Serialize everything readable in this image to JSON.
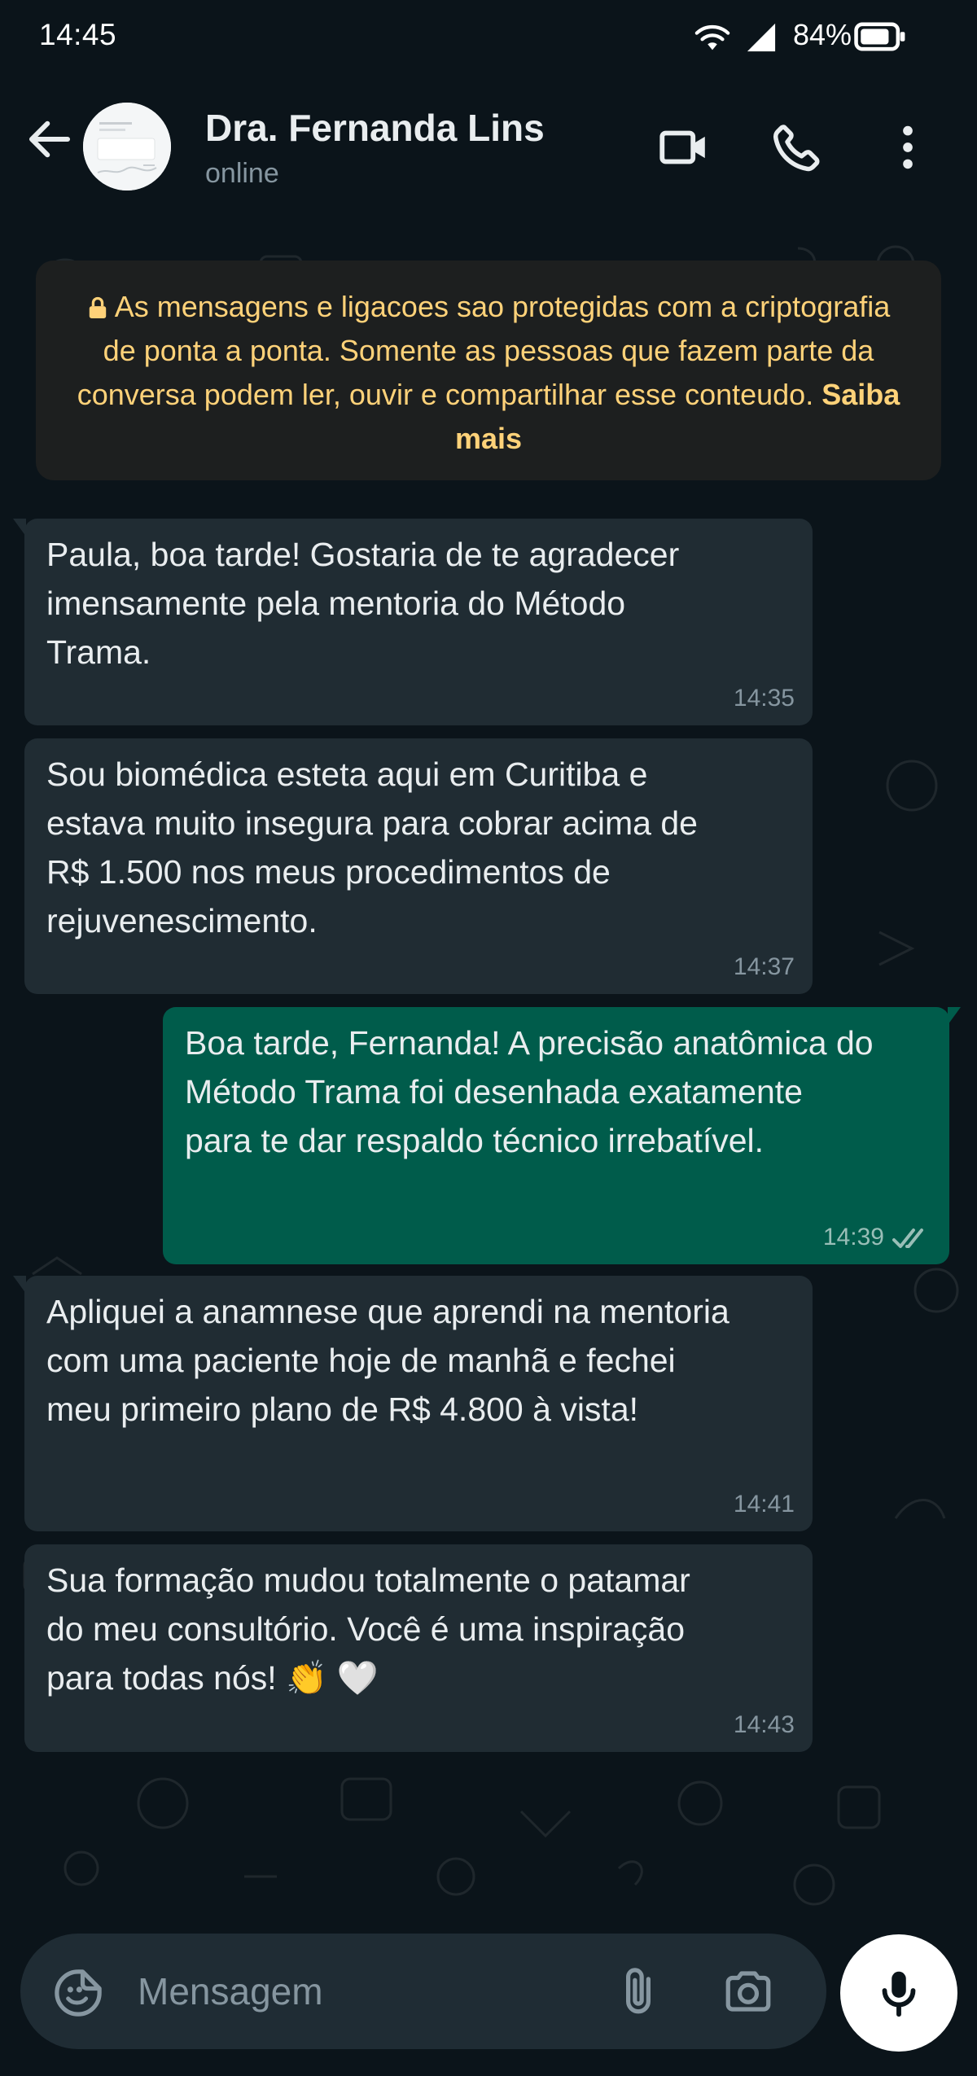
{
  "status_bar": {
    "time": "14:45",
    "battery": "84%"
  },
  "header": {
    "contact_name": "Dra. Fernanda Lins",
    "contact_status": "online"
  },
  "encryption_notice": {
    "text": "As mensagens e ligacoes sao protegidas com a criptografia de ponta a ponta. Somente as pessoas que fazem parte da conversa podem ler, ouvir e compartilhar esse conteudo.",
    "link": "Saiba mais"
  },
  "messages": [
    {
      "direction": "in",
      "text": "Paula, boa tarde! Gostaria de te agradecer\nimensamente pela mentoria do Método\nTrama.",
      "time": "14:35"
    },
    {
      "direction": "in",
      "text": "Sou biomédica esteta aqui em Curitiba e\nestava muito insegura para cobrar acima de\nR$ 1.500 nos meus procedimentos de\nrejuvenescimento.",
      "time": "14:37"
    },
    {
      "direction": "out",
      "text": "Boa tarde, Fernanda! A precisão anatômica do\nMétodo Trama foi desenhada exatamente\npara te dar respaldo técnico irrebatível.",
      "time": "14:39",
      "status": "read"
    },
    {
      "direction": "in",
      "text": "Apliquei a anamnese que aprendi na mentoria\ncom uma paciente hoje de manhã e fechei\nmeu primeiro plano de R$ 4.800 à vista!",
      "time": "14:41"
    },
    {
      "direction": "in",
      "text": "Sua formação mudou totalmente o patamar\ndo meu consultório. Você é uma inspiração\npara todas nós! 👏 🤍",
      "time": "14:43"
    }
  ],
  "composer": {
    "placeholder": "Mensagem"
  },
  "colors": {
    "background": "#0b141a",
    "incoming_bubble": "#202c33",
    "outgoing_bubble": "#005c4b",
    "notice_text": "#ffd279",
    "read_ticks": "#99beb7"
  }
}
